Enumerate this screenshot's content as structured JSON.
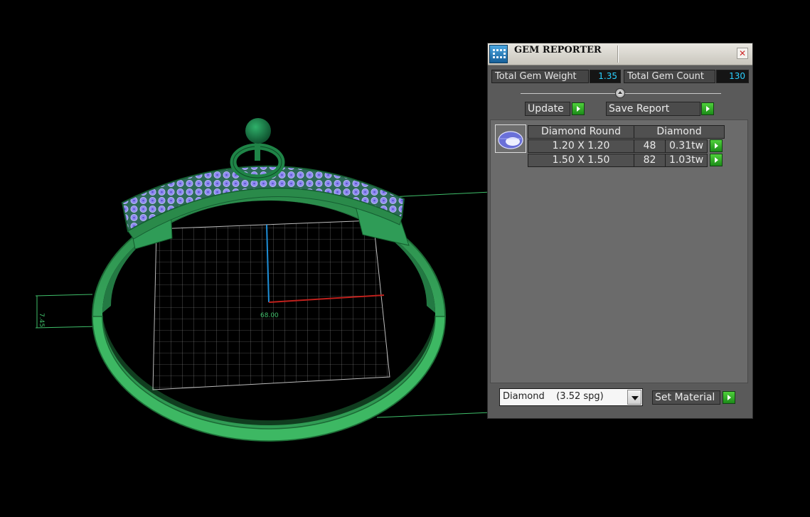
{
  "viewport": {
    "dimension_top": "7.45",
    "dimension_center": "68.00"
  },
  "gem_reporter": {
    "title": "GEM REPORTER",
    "close_icon": "close-icon",
    "total_gem_weight_label": "Total Gem Weight",
    "total_gem_weight_value": "1.35",
    "total_gem_count_label": "Total Gem Count",
    "total_gem_count_value": "130",
    "update_label": "Update",
    "save_report_label": "Save Report",
    "gem_list": {
      "shape_header": "Diamond Round",
      "material_header": "Diamond",
      "rows": [
        {
          "size": "1.20 X 1.20",
          "count": "48",
          "weight": "0.31tw"
        },
        {
          "size": "1.50 X 1.50",
          "count": "82",
          "weight": "1.03tw"
        }
      ]
    },
    "material_select_value": "Diamond    (3.52 spg)",
    "set_material_label": "Set Material"
  },
  "colors": {
    "model_green": "#2fa85a",
    "gem_blue": "#8f8cf0",
    "value_cyan": "#2ad0ff",
    "button_green": "#33b52a"
  }
}
